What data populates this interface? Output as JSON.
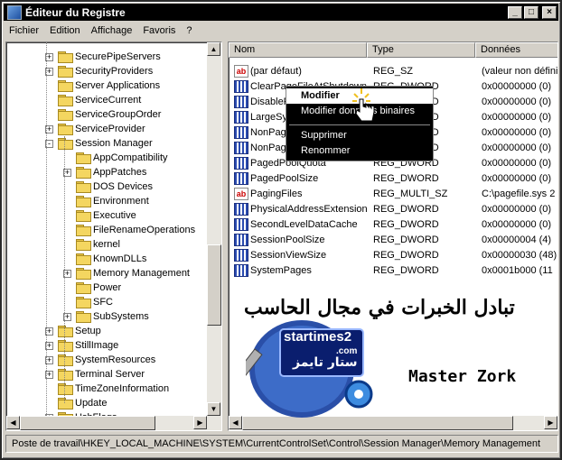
{
  "window": {
    "title": "Éditeur du Registre"
  },
  "menu": [
    "Fichier",
    "Edition",
    "Affichage",
    "Favoris",
    "?"
  ],
  "tree": [
    {
      "label": "SecurePipeServers",
      "level": 0,
      "exp": "+"
    },
    {
      "label": "SecurityProviders",
      "level": 0,
      "exp": "+"
    },
    {
      "label": "Server Applications",
      "level": 0,
      "exp": ""
    },
    {
      "label": "ServiceCurrent",
      "level": 0,
      "exp": ""
    },
    {
      "label": "ServiceGroupOrder",
      "level": 0,
      "exp": ""
    },
    {
      "label": "ServiceProvider",
      "level": 0,
      "exp": "+"
    },
    {
      "label": "Session Manager",
      "level": 0,
      "exp": "-"
    },
    {
      "label": "AppCompatibility",
      "level": 1,
      "exp": ""
    },
    {
      "label": "AppPatches",
      "level": 1,
      "exp": "+"
    },
    {
      "label": "DOS Devices",
      "level": 1,
      "exp": ""
    },
    {
      "label": "Environment",
      "level": 1,
      "exp": ""
    },
    {
      "label": "Executive",
      "level": 1,
      "exp": ""
    },
    {
      "label": "FileRenameOperations",
      "level": 1,
      "exp": ""
    },
    {
      "label": "kernel",
      "level": 1,
      "exp": ""
    },
    {
      "label": "KnownDLLs",
      "level": 1,
      "exp": ""
    },
    {
      "label": "Memory Management",
      "level": 1,
      "exp": "+"
    },
    {
      "label": "Power",
      "level": 1,
      "exp": ""
    },
    {
      "label": "SFC",
      "level": 1,
      "exp": ""
    },
    {
      "label": "SubSystems",
      "level": 1,
      "exp": "+"
    },
    {
      "label": "Setup",
      "level": 0,
      "exp": "+"
    },
    {
      "label": "StillImage",
      "level": 0,
      "exp": "+"
    },
    {
      "label": "SystemResources",
      "level": 0,
      "exp": "+"
    },
    {
      "label": "Terminal Server",
      "level": 0,
      "exp": "+"
    },
    {
      "label": "TimeZoneInformation",
      "level": 0,
      "exp": ""
    },
    {
      "label": "Update",
      "level": 0,
      "exp": ""
    },
    {
      "label": "UsbFlags",
      "level": 0,
      "exp": "+"
    }
  ],
  "columns": {
    "name": "Nom",
    "type": "Type",
    "data": "Données"
  },
  "values": [
    {
      "name": "(par défaut)",
      "type": "REG_SZ",
      "data": "(valeur non défini",
      "icon": "sz"
    },
    {
      "name": "ClearPageFileAtShutdown",
      "type": "REG_DWORD",
      "data": "0x00000000 (0)",
      "icon": "bin"
    },
    {
      "name": "DisablePagingExecutive",
      "type": "REG_DWORD",
      "data": "0x00000000 (0)",
      "icon": "bin"
    },
    {
      "name": "LargeSystemCache",
      "type": "REG_DWORD",
      "data": "0x00000000 (0)",
      "icon": "bin"
    },
    {
      "name": "NonPagedPoolQuota",
      "type": "REG_DWORD",
      "data": "0x00000000 (0)",
      "icon": "bin"
    },
    {
      "name": "NonPagedPoolSize",
      "type": "REG_DWORD",
      "data": "0x00000000 (0)",
      "icon": "bin"
    },
    {
      "name": "PagedPoolQuota",
      "type": "REG_DWORD",
      "data": "0x00000000 (0)",
      "icon": "bin"
    },
    {
      "name": "PagedPoolSize",
      "type": "REG_DWORD",
      "data": "0x00000000 (0)",
      "icon": "bin"
    },
    {
      "name": "PagingFiles",
      "type": "REG_MULTI_SZ",
      "data": "C:\\pagefile.sys 2",
      "icon": "sz"
    },
    {
      "name": "PhysicalAddressExtension",
      "type": "REG_DWORD",
      "data": "0x00000000 (0)",
      "icon": "bin"
    },
    {
      "name": "SecondLevelDataCache",
      "type": "REG_DWORD",
      "data": "0x00000000 (0)",
      "icon": "bin"
    },
    {
      "name": "SessionPoolSize",
      "type": "REG_DWORD",
      "data": "0x00000004 (4)",
      "icon": "bin"
    },
    {
      "name": "SessionViewSize",
      "type": "REG_DWORD",
      "data": "0x00000030 (48)",
      "icon": "bin"
    },
    {
      "name": "SystemPages",
      "type": "REG_DWORD",
      "data": "0x0001b000 (11",
      "icon": "bin"
    }
  ],
  "context_menu": {
    "modify": "Modifier",
    "modify_binary": "Modifier données binaires",
    "delete": "Supprimer",
    "rename": "Renommer"
  },
  "status": "Poste de travail\\HKEY_LOCAL_MACHINE\\SYSTEM\\CurrentControlSet\\Control\\Session Manager\\Memory Management",
  "watermark": {
    "arabic": "تبادل الخبرات في مجال الحاسب",
    "site": "startimes2",
    "site_tld": ".com",
    "site_arabic": "ستار تايمز",
    "author": "Master Zork"
  }
}
